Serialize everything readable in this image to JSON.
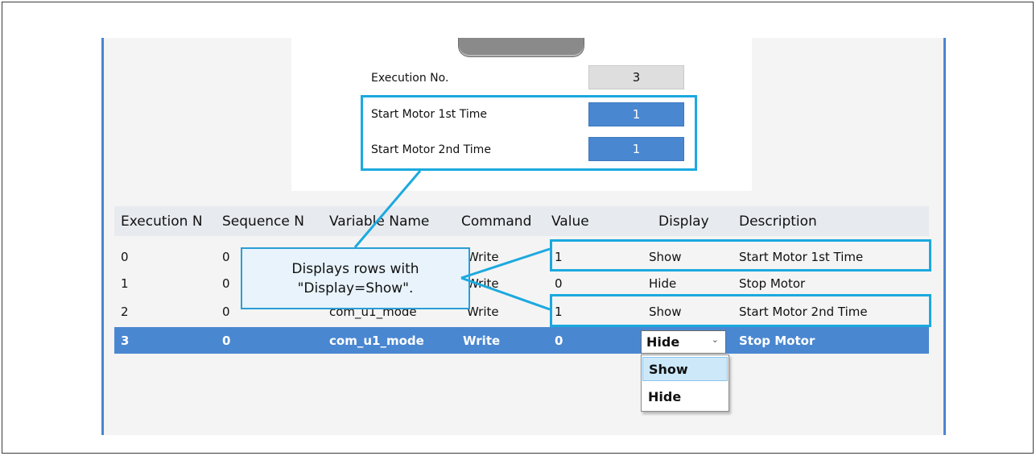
{
  "form": {
    "execution_no": {
      "label": "Execution No.",
      "value": "3"
    },
    "fields": [
      {
        "label": "Start Motor 1st Time",
        "value": "1"
      },
      {
        "label": "Start Motor 2nd Time",
        "value": "1"
      }
    ]
  },
  "table": {
    "columns": [
      "Execution N",
      "Sequence N",
      "Variable Name",
      "Command",
      "Value",
      "Display",
      "Description"
    ],
    "rows": [
      {
        "execution": "0",
        "sequence": "0",
        "variable": "",
        "command": "Write",
        "value": "1",
        "display": "Show",
        "description": "Start Motor 1st Time"
      },
      {
        "execution": "1",
        "sequence": "0",
        "variable": "",
        "command": "Write",
        "value": "0",
        "display": "Hide",
        "description": "Stop Motor"
      },
      {
        "execution": "2",
        "sequence": "0",
        "variable": "com_u1_mode",
        "command": "Write",
        "value": "1",
        "display": "Show",
        "description": "Start Motor 2nd Time"
      },
      {
        "execution": "3",
        "sequence": "0",
        "variable": "com_u1_mode",
        "command": "Write",
        "value": "0",
        "display": "Hide",
        "description": "Stop Motor"
      }
    ]
  },
  "dropdown": {
    "selected": "Hide",
    "options": [
      "Show",
      "Hide"
    ]
  },
  "callout": {
    "line1": "Displays rows with",
    "line2": "\"Display=Show\"."
  },
  "colors": {
    "accent": "#4a87d1",
    "highlight": "#1ba9df",
    "selected_row": "#4a87d1"
  }
}
